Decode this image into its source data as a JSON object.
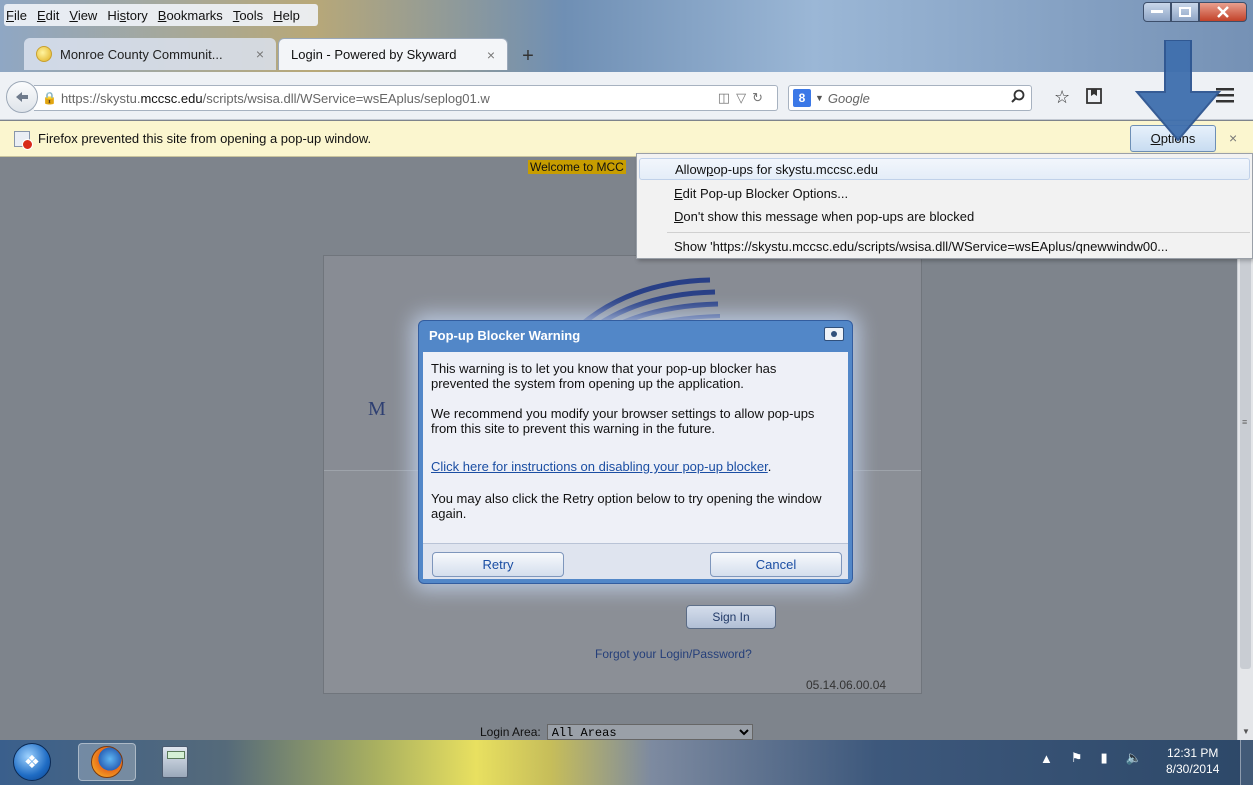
{
  "menubar": [
    {
      "pre": "",
      "key": "F",
      "post": "ile"
    },
    {
      "pre": "",
      "key": "E",
      "post": "dit"
    },
    {
      "pre": "",
      "key": "V",
      "post": "iew"
    },
    {
      "pre": "Hi",
      "key": "s",
      "post": "tory"
    },
    {
      "pre": "",
      "key": "B",
      "post": "ookmarks"
    },
    {
      "pre": "",
      "key": "T",
      "post": "ools"
    },
    {
      "pre": "",
      "key": "H",
      "post": "elp"
    }
  ],
  "tabs": [
    {
      "label": "Monroe County Communit...",
      "close": "×"
    },
    {
      "label": "Login - Powered by Skyward",
      "close": "×"
    }
  ],
  "newtab": "+",
  "url": {
    "pre": "https://skystu.",
    "host": "mccsc.edu",
    "post": "/scripts/wsisa.dll/WService=wsEAplus/seplog01.w"
  },
  "search": {
    "engine": "8",
    "placeholder": "Google"
  },
  "notification": {
    "message": "Firefox prevented this site from opening a pop-up window.",
    "options_pre": "",
    "options_key": "O",
    "options_post": "ptions",
    "close": "×"
  },
  "context_menu": [
    {
      "pre": "Allow ",
      "key": "p",
      "post": "op-ups for skystu.mccsc.edu"
    },
    {
      "pre": "",
      "key": "E",
      "post": "dit Pop-up Blocker Options..."
    },
    {
      "pre": "",
      "key": "D",
      "post": "on't show this message when pop-ups are blocked"
    },
    {
      "pre": "Show 'https://skystu.mccsc.edu/scripts/wsisa.dll/WService=wsEAplus/qnewwindw00...",
      "key": "",
      "post": ""
    }
  ],
  "page": {
    "welcome": "Welcome to MCC",
    "m_label": "M",
    "sign_in": "Sign In",
    "forgot": "Forgot your Login/Password?",
    "version": "05.14.06.00.04",
    "login_area_label": "Login Area:",
    "login_area_value": "All Areas"
  },
  "dialog": {
    "title": "Pop-up Blocker Warning",
    "p1": "This warning is to let you know that your pop-up blocker has prevented the system from opening up the application.",
    "p2": "We recommend you modify your browser settings to allow pop-ups from this site to prevent this warning in the future.",
    "link": "Click here for instructions on disabling your pop-up blocker",
    "link_suffix": ".",
    "p3": "You may also click the Retry option below to try opening the window again.",
    "retry": "Retry",
    "cancel": "Cancel"
  },
  "clock": {
    "time": "12:31 PM",
    "date": "8/30/2014"
  },
  "colors": {
    "annotation_arrow": "#3f6fae",
    "dialog_frame": "#5287c8",
    "notification_bg": "#fbf6cf"
  }
}
